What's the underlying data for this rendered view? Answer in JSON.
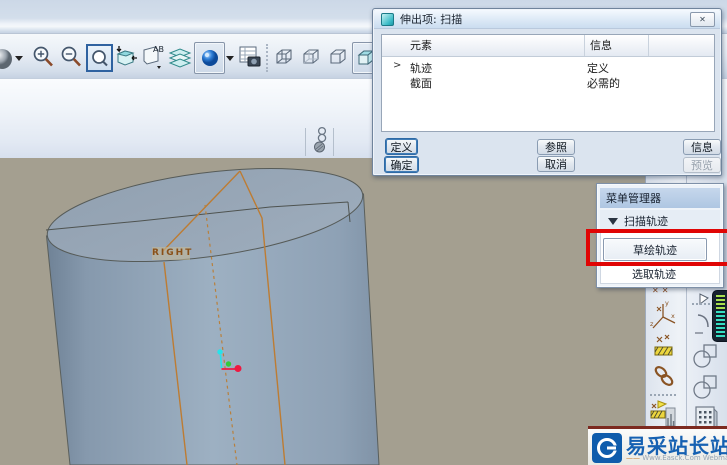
{
  "dialog": {
    "title": "伸出项: 扫描",
    "close_glyph": "✕",
    "table": {
      "columns": [
        "元素",
        "信息"
      ],
      "rows": [
        {
          "marker": ">",
          "element": "轨迹",
          "info": "定义"
        },
        {
          "marker": "",
          "element": "截面",
          "info": "必需的"
        }
      ]
    },
    "buttons": {
      "define": "定义",
      "references": "参照",
      "info": "信息",
      "ok": "确定",
      "cancel": "取消",
      "preview": "预览"
    }
  },
  "menu_manager": {
    "title": "菜单管理器",
    "section": "扫描轨迹",
    "items": [
      {
        "label": "草绘轨迹",
        "highlighted": true
      },
      {
        "label": "选取轨迹",
        "highlighted": false
      }
    ]
  },
  "viewport": {
    "datum_label": "RIGHT"
  },
  "watermark": {
    "site_name": "易采站长站",
    "dash": "——",
    "subtitle": "Www.Easck.Com Webmaster"
  },
  "toolbar": {
    "icons": [
      "render-style-sphere",
      "dropdown-arrow",
      "zoom-in",
      "zoom-out",
      "zoom-refit",
      "repaint",
      "annotation-ab",
      "layers",
      "shaded-display-ball",
      "dropdown-arrow",
      "view-manager",
      "wireframe-cube",
      "hidden-line-cube",
      "no-hidden-cube",
      "shaded-cube"
    ]
  },
  "secondary_toolbar": {
    "icons": [
      "sketch-point"
    ]
  },
  "right_toolbar": {
    "icons": [
      "datum-points",
      "coordinate-system",
      "datum-point-hatch",
      "chain-link",
      "analysis-flag",
      "flag-outline",
      "fillet-arc",
      "circle-rect",
      "circle-rect",
      "grid-pattern",
      "color-scale"
    ]
  },
  "colors": {
    "annotation_red": "#e00505",
    "datum_orange": "#bd7c33",
    "viewport_background": "#a49f90",
    "csys_x_red": "#ef1840",
    "csys_green": "#30cc3a",
    "csys_cyan": "#25e3ea",
    "logo_blue": "#0f5cac"
  }
}
